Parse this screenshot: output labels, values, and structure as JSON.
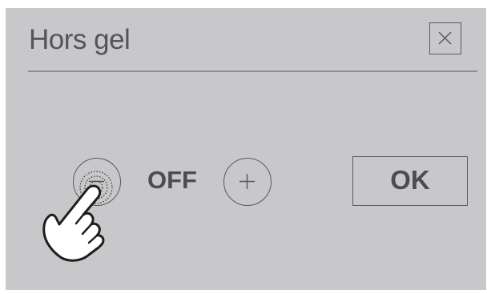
{
  "dialog": {
    "title": "Hors gel",
    "close_icon": "close-icon",
    "value": "OFF",
    "decrease_icon": "minus-icon",
    "increase_icon": "plus-icon",
    "ok_label": "OK"
  },
  "overlay": {
    "icon": "tapping-hand-icon"
  },
  "colors": {
    "screen_background": "#c8c8ca",
    "text": "#4d4d4f",
    "outline": "#5a5a5c",
    "divider": "#8e8e90"
  }
}
